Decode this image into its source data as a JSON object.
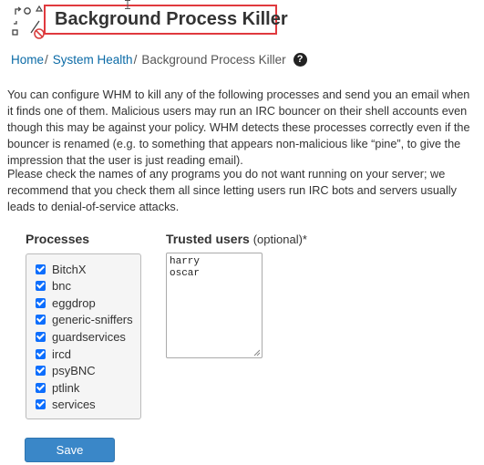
{
  "header": {
    "title": "Background Process Killer",
    "logo_icon": "process-killer-icon"
  },
  "breadcrumb": {
    "items": [
      "Home",
      "System Health"
    ],
    "current": "Background Process Killer",
    "separator": "/",
    "help_icon": "question-circle-icon"
  },
  "description": {
    "p1": "You can configure WHM to kill any of the following processes and send you an email when it finds one of them. Malicious users may run an IRC bouncer on their shell accounts even though this may be against your policy. WHM detects these processes correctly even if the bouncer is renamed (e.g. to something that appears non-malicious like “pine”, to give the impression that the user is just reading email).",
    "p2": "Please check the names of any programs you do not want running on your server; we recommend that you check them all since letting users run IRC bots and servers usually leads to denial-of-service attacks."
  },
  "processes": {
    "label": "Processes",
    "items": [
      {
        "name": "BitchX",
        "checked": true
      },
      {
        "name": "bnc",
        "checked": true
      },
      {
        "name": "eggdrop",
        "checked": true
      },
      {
        "name": "generic-sniffers",
        "checked": true
      },
      {
        "name": "guardservices",
        "checked": true
      },
      {
        "name": "ircd",
        "checked": true
      },
      {
        "name": "psyBNC",
        "checked": true
      },
      {
        "name": "ptlink",
        "checked": true
      },
      {
        "name": "services",
        "checked": true
      }
    ]
  },
  "trusted_users": {
    "label": "Trusted users",
    "optional": "(optional)",
    "asterisk": "*",
    "value": "harry\noscar"
  },
  "save_button": {
    "label": "Save"
  },
  "colors": {
    "title_border": "#e0393e",
    "link": "#0a6aa6",
    "button": "#3a87c8",
    "checkbox": "#0d6efd"
  }
}
